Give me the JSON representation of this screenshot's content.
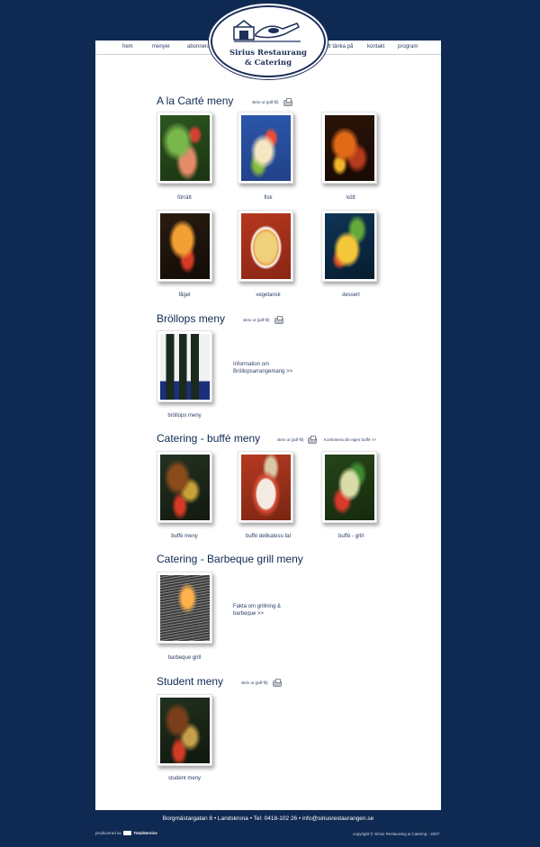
{
  "nav": {
    "items": [
      "hem",
      "menyer",
      "abonnera",
      "att tänka på",
      "kontakt",
      "program"
    ]
  },
  "logo": {
    "line1": "Sirius Restaurang",
    "line2": "& Catering"
  },
  "sections": {
    "alacarte": {
      "title": "A la Carté meny",
      "print_link": "skriv ut (pdf-fil)",
      "items": [
        "förrätt",
        "fisk",
        "kött",
        "fågel",
        "vegetarisk",
        "dessert"
      ]
    },
    "brollops": {
      "title": "Bröllops meny",
      "print_link": "skriv ut (pdf-fil)",
      "items": [
        "bröllops meny"
      ],
      "info": "Information om Bröllopsarrangemang >>"
    },
    "buffe": {
      "title": "Catering - buffé meny",
      "print_link": "skriv ut (pdf-fil)",
      "extra_link": "Kombinera din egen buffé >>",
      "items": [
        "buffé meny",
        "buffé delikatess-fat",
        "buffé - grill"
      ]
    },
    "bbq": {
      "title": "Catering - Barbeque grill meny",
      "items": [
        "barbeque grill"
      ],
      "info": "Fakta om grillning & barbeque >>"
    },
    "student": {
      "title": "Student meny",
      "print_link": "skriv ut (pdf-fil)",
      "items": [
        "student meny"
      ]
    }
  },
  "footer": {
    "address": "Borgmästargatan 8   •   Landskrona   •   Tel: 0418-102 26   •   info@siriusrestaurangen.se",
    "produced_by": "producerad av",
    "producer_name": "TotalService",
    "copyright": "copyright © Sirius Restaurang & Catering - 2007"
  },
  "colors": {
    "background": "#0f2a52",
    "page": "#ffffff",
    "heading": "#0f2a52"
  },
  "icons": [
    "printer-icon",
    "logo-emblem"
  ]
}
